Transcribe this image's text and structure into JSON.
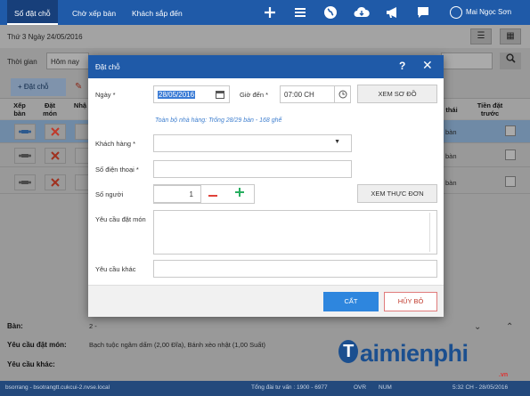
{
  "nav": {
    "tabs": [
      "Sổ đặt chỗ",
      "Chờ xếp bàn",
      "Khách sắp đến"
    ],
    "icons": [
      "plus-icon",
      "menu-icon",
      "globe-icon",
      "cloud-download-icon",
      "megaphone-icon",
      "chat-icon"
    ],
    "user": "Mai Ngọc Sơn"
  },
  "page": {
    "date": "Thứ 3 Ngày 24/05/2016",
    "time_label": "Thời gian",
    "time_value": "Hôm nay",
    "add_button": "Đặt chỗ",
    "columns": [
      "Xếp bàn",
      "Đặt món",
      "Nhậ",
      "thái",
      "Tiền đặt trước"
    ],
    "rows": [
      {
        "status": "bàn",
        "selected": true
      },
      {
        "status": "bàn",
        "selected": false
      },
      {
        "status": "bàn",
        "selected": false
      }
    ]
  },
  "bottom": {
    "table_label": "Bàn:",
    "table_value": "2 -",
    "order_label": "Yêu cầu đặt món:",
    "order_value": "Bạch tuộc ngâm dấm (2,00 Đĩa), Bánh xèo nhật (1,00 Suất)",
    "other_label": "Yêu cầu khác:"
  },
  "status_bar": {
    "left": "bsorrang - bsotrangtt.cukcui-2.nvse.local",
    "total": "Tổng đài tư vấn : 1900 - 6977",
    "ovr": "OVR",
    "num": "NUM",
    "time": "5:32 CH - 28/05/2016"
  },
  "modal": {
    "title": "Đặt chỗ",
    "date_label": "Ngày *",
    "date_value": "28/05/2016",
    "time_label": "Giờ đến *",
    "time_value": "07:00 CH",
    "view_map_button": "XEM SƠ ĐỒ",
    "note": "Toàn bộ nhà hàng: Trống 28/29 bàn - 168 ghế",
    "customer_label": "Khách hàng *",
    "phone_label": "Số điện thoại *",
    "guests_label": "Số người",
    "guests_value": "1",
    "view_menu_button": "XEM THỰC ĐƠN",
    "order_label": "Yêu cầu đặt món",
    "other_label": "Yêu cầu khác",
    "ok_button": "CẤT",
    "cancel_button": "HỦY BỎ"
  },
  "watermark": {
    "text": "aimienphi",
    "letter": "T",
    "sub": ".vn"
  },
  "colors": {
    "nav_blue": "#1f5aa8",
    "primary_button": "#2e86de",
    "cancel_border": "#e07b7b",
    "note_blue": "#3f7fcf",
    "minus_red": "#e0413a",
    "plus_green": "#27ae60"
  }
}
